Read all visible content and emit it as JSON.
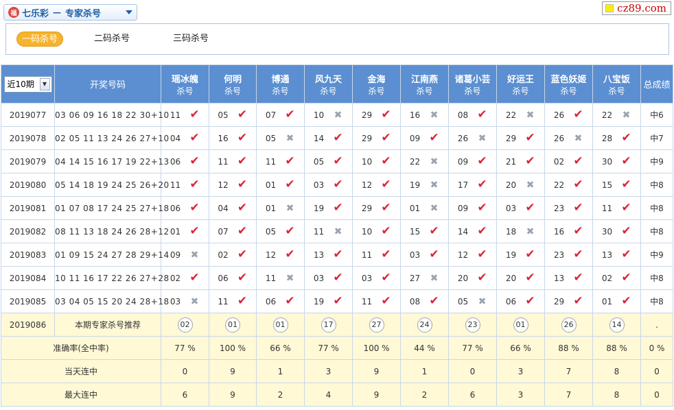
{
  "header": {
    "app_title": "七乐彩",
    "separator": "—",
    "section_title": "专家杀号",
    "logo_text": "福"
  },
  "watermark": {
    "text": "cz89.com"
  },
  "tabs": [
    {
      "label": "一码杀号",
      "active": true
    },
    {
      "label": "二码杀号",
      "active": false
    },
    {
      "label": "三码杀号",
      "active": false
    }
  ],
  "table": {
    "period_select": "近10期",
    "draw_header": "开奖号码",
    "total_header": "总成绩",
    "expert_sub": "杀号",
    "experts": [
      "瑶冰魄",
      "何明",
      "博通",
      "风九天",
      "金海",
      "江南燕",
      "诸葛小芸",
      "好运王",
      "蓝色妖姬",
      "八宝饭"
    ],
    "rows": [
      {
        "issue": "2019077",
        "numbers": "03 06 09 16 18 22 30+10",
        "picks": [
          "11",
          "05",
          "07",
          "10",
          "29",
          "16",
          "08",
          "22",
          "26",
          "22"
        ],
        "hits": [
          true,
          true,
          true,
          false,
          true,
          false,
          true,
          false,
          true,
          false
        ],
        "total": "中6"
      },
      {
        "issue": "2019078",
        "numbers": "02 05 11 13 24 26 27+10",
        "picks": [
          "04",
          "16",
          "05",
          "14",
          "29",
          "09",
          "26",
          "29",
          "26",
          "28"
        ],
        "hits": [
          true,
          true,
          false,
          true,
          true,
          true,
          false,
          true,
          false,
          true
        ],
        "total": "中7"
      },
      {
        "issue": "2019079",
        "numbers": "04 14 15 16 17 19 22+13",
        "picks": [
          "06",
          "11",
          "11",
          "05",
          "10",
          "22",
          "09",
          "21",
          "02",
          "30"
        ],
        "hits": [
          true,
          true,
          true,
          true,
          true,
          false,
          true,
          true,
          true,
          true
        ],
        "total": "中9"
      },
      {
        "issue": "2019080",
        "numbers": "05 14 18 19 24 25 26+20",
        "picks": [
          "11",
          "12",
          "01",
          "03",
          "12",
          "19",
          "17",
          "20",
          "22",
          "15"
        ],
        "hits": [
          true,
          true,
          true,
          true,
          true,
          false,
          true,
          false,
          true,
          true
        ],
        "total": "中8"
      },
      {
        "issue": "2019081",
        "numbers": "01 07 08 17 24 25 27+18",
        "picks": [
          "06",
          "04",
          "01",
          "19",
          "29",
          "01",
          "09",
          "03",
          "23",
          "11"
        ],
        "hits": [
          true,
          true,
          false,
          true,
          true,
          false,
          true,
          true,
          true,
          true
        ],
        "total": "中8"
      },
      {
        "issue": "2019082",
        "numbers": "08 11 13 18 24 26 28+12",
        "picks": [
          "01",
          "07",
          "05",
          "11",
          "10",
          "15",
          "14",
          "18",
          "16",
          "30"
        ],
        "hits": [
          true,
          true,
          true,
          false,
          true,
          true,
          true,
          false,
          true,
          true
        ],
        "total": "中8"
      },
      {
        "issue": "2019083",
        "numbers": "01 09 15 24 27 28 29+14",
        "picks": [
          "09",
          "02",
          "12",
          "13",
          "11",
          "03",
          "12",
          "19",
          "23",
          "13"
        ],
        "hits": [
          false,
          true,
          true,
          true,
          true,
          true,
          true,
          true,
          true,
          true
        ],
        "total": "中9"
      },
      {
        "issue": "2019084",
        "numbers": "10 11 16 17 22 26 27+28",
        "picks": [
          "02",
          "06",
          "11",
          "03",
          "03",
          "27",
          "20",
          "20",
          "13",
          "02"
        ],
        "hits": [
          true,
          true,
          false,
          true,
          true,
          false,
          true,
          true,
          true,
          true
        ],
        "total": "中8"
      },
      {
        "issue": "2019085",
        "numbers": "03 04 05 15 20 24 28+18",
        "picks": [
          "03",
          "11",
          "06",
          "19",
          "11",
          "08",
          "05",
          "06",
          "29",
          "01"
        ],
        "hits": [
          false,
          true,
          true,
          true,
          true,
          true,
          false,
          true,
          true,
          true
        ],
        "total": "中8"
      }
    ],
    "recommend": {
      "issue": "2019086",
      "label": "本期专家杀号推荐",
      "picks": [
        "02",
        "01",
        "01",
        "17",
        "27",
        "24",
        "23",
        "01",
        "26",
        "14"
      ],
      "total": "."
    },
    "stats": [
      {
        "label": "准确率(全中率)",
        "values": [
          "77 %",
          "100 %",
          "66 %",
          "77 %",
          "100 %",
          "44 %",
          "77 %",
          "66 %",
          "88 %",
          "88 %"
        ],
        "total": "0 %"
      },
      {
        "label": "当天连中",
        "values": [
          "0",
          "9",
          "1",
          "3",
          "9",
          "1",
          "0",
          "3",
          "7",
          "8"
        ],
        "total": "0"
      },
      {
        "label": "最大连中",
        "values": [
          "6",
          "9",
          "2",
          "4",
          "9",
          "2",
          "6",
          "3",
          "7",
          "8"
        ],
        "total": "0"
      }
    ],
    "colors": {
      "header_bg": "#5b8fd1",
      "hit": "#d9253b",
      "miss": "#9aa3ad",
      "footer_bg": "#fff9d6",
      "tab_active": "#f6b32b"
    }
  }
}
